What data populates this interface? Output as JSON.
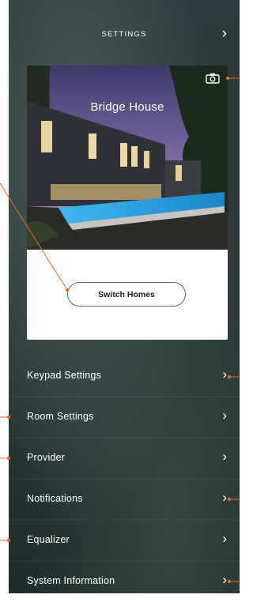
{
  "header": {
    "title": "SETTINGS",
    "forward_icon": "chevron-right-icon"
  },
  "home": {
    "name": "Bridge House",
    "photo_icon": "camera-icon",
    "switch_label": "Switch Homes"
  },
  "menu": {
    "items": [
      {
        "label": "Keypad Settings"
      },
      {
        "label": "Room Settings"
      },
      {
        "label": "Provider"
      },
      {
        "label": "Notifications"
      },
      {
        "label": "Equalizer"
      },
      {
        "label": "System Information"
      }
    ]
  },
  "colors": {
    "panel_background": "#2a3838",
    "callout_line": "#e8692d",
    "card_background": "#ffffff",
    "text": "#ffffff"
  }
}
